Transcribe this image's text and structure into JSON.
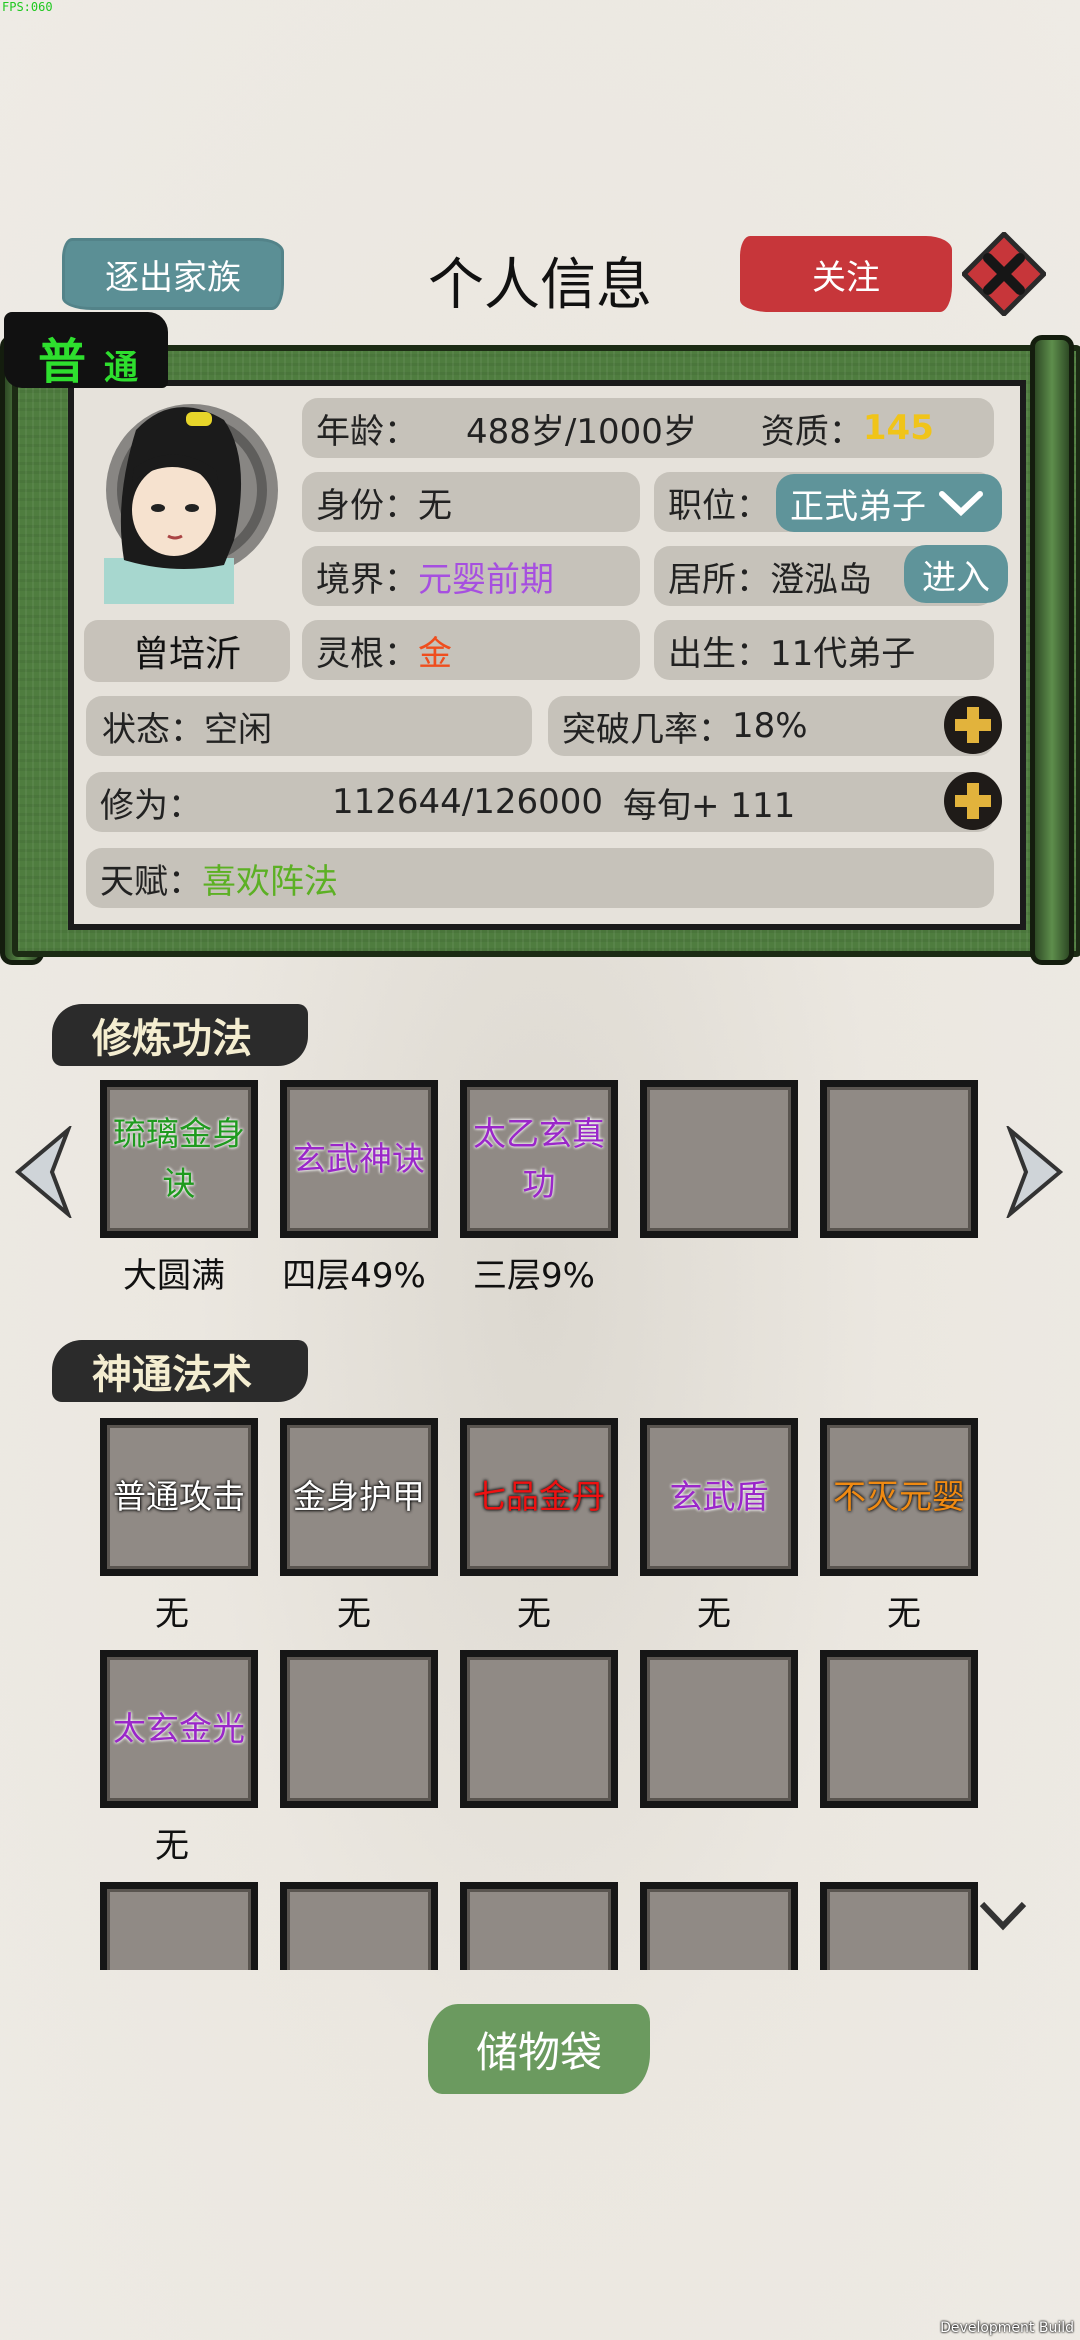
{
  "debug": {
    "fps": "FPS:060",
    "build": "Development Build"
  },
  "header": {
    "title": "个人信息",
    "expel_label": "逐出家族",
    "follow_label": "关注"
  },
  "grade": {
    "char1": "普",
    "char2": "通"
  },
  "character": {
    "name": "曾培沂",
    "age_label": "年龄：",
    "age_value": "488岁/1000岁",
    "aptitude_label": "资质：",
    "aptitude_value": "145",
    "identity_label": "身份：无",
    "position_label": "职位：",
    "position_value": "正式弟子",
    "realm_label": "境界：",
    "realm_value": "元婴前期",
    "residence_label": "居所：",
    "residence_value": "澄泓岛",
    "enter_label": "进入",
    "root_label": "灵根：",
    "root_value": "金",
    "birth_label": "出生：",
    "birth_value": "11代弟子",
    "status_label": "状态：空闲",
    "breakthrough_label": "突破几率：",
    "breakthrough_value": "18%",
    "cultivation_label": "修为：",
    "cultivation_value": "112644/126000",
    "cultivation_rate": "每旬+ 111",
    "talent_label": "天赋：",
    "talent_value": "喜欢阵法"
  },
  "techniques": {
    "title": "修炼功法",
    "slots": [
      {
        "name": "琉璃金身诀",
        "progress": "大圆满"
      },
      {
        "name": "玄武神诀",
        "progress": "四层49%"
      },
      {
        "name": "太乙玄真功",
        "progress": "三层9%"
      },
      {
        "name": "",
        "progress": ""
      },
      {
        "name": "",
        "progress": ""
      }
    ]
  },
  "spells": {
    "title": "神通法术",
    "slots": [
      {
        "name": "普通攻击",
        "level": "无"
      },
      {
        "name": "金身护甲",
        "level": "无"
      },
      {
        "name": "七品金丹",
        "level": "无"
      },
      {
        "name": "玄武盾",
        "level": "无"
      },
      {
        "name": "不灭元婴",
        "level": "无"
      },
      {
        "name": "太玄金光",
        "level": "无"
      }
    ]
  },
  "footer": {
    "storage_label": "储物袋"
  },
  "colors": {
    "gold": "#f0c419",
    "purple": "#a64fe0",
    "orange_red": "#ef4e1e",
    "green": "#5cb024",
    "teal": "#5f949a",
    "red": "#c7363a"
  }
}
